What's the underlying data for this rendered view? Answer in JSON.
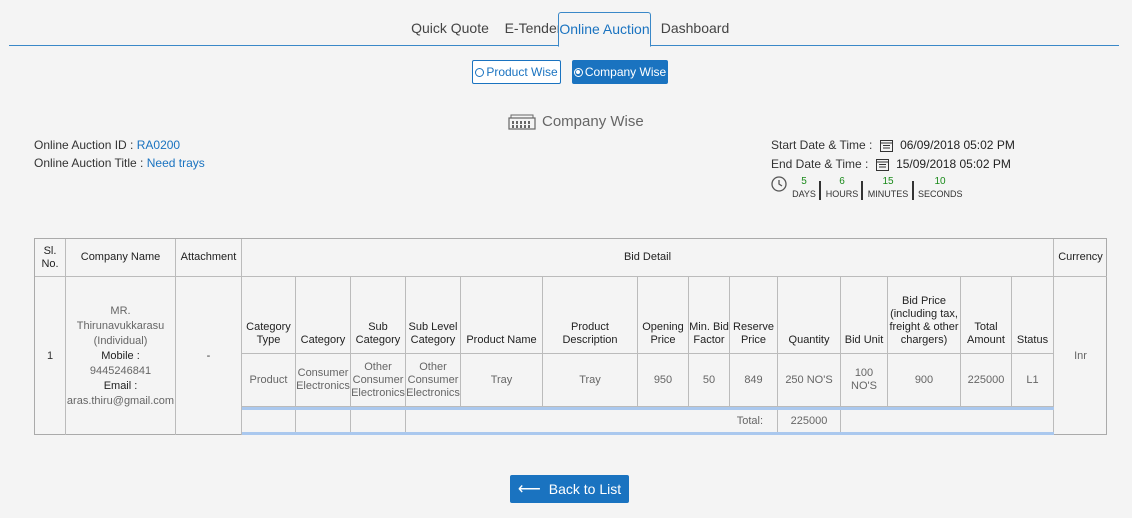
{
  "tabs": [
    {
      "label": "Quick Quote"
    },
    {
      "label": "E-Tender"
    },
    {
      "label": "Online Auction"
    },
    {
      "label": "Dashboard"
    }
  ],
  "toggle": {
    "product_wise": "Product Wise",
    "company_wise": "Company Wise"
  },
  "section_title": "Company Wise",
  "auction": {
    "id_label": "Online Auction ID :",
    "id_value": "RA0200",
    "title_label": "Online Auction Title :",
    "title_value": "Need trays",
    "start_label": "Start Date & Time  :",
    "start_value": "06/09/2018 05:02 PM",
    "end_label": "End Date & Time  :",
    "end_value": "15/09/2018 05:02 PM"
  },
  "countdown": {
    "days": "5",
    "days_label": "DAYS",
    "hours": "6",
    "hours_label": "HOURS",
    "minutes": "15",
    "minutes_label": "MINUTES",
    "seconds": "10",
    "seconds_label": "SECONDS"
  },
  "table": {
    "headers": {
      "sl": "Sl. No.",
      "company": "Company Name",
      "attachment": "Attachment",
      "bid_detail": "Bid Detail",
      "currency": "Currency"
    },
    "sub_headers": [
      "Category Type",
      "Category",
      "Sub Category",
      "Sub Level Category",
      "Product Name",
      "Product Description",
      "Opening Price",
      "Min. Bid Factor",
      "Reserve Price",
      "Quantity",
      "Bid Unit",
      "Bid Price (including tax, freight & other chargers)",
      "Total Amount",
      "Status"
    ],
    "row": {
      "sl": "1",
      "company_name": "MR. Thirunavukkarasu (Individual)",
      "mobile_label": "Mobile :",
      "mobile": "9445246841",
      "email_label": "Email :",
      "email": "aras.thiru@gmail.com",
      "attachment": "-",
      "currency": "Inr",
      "cells": [
        "Product",
        "Consumer Electronics",
        "Other Consumer Electronics",
        "Other Consumer Electronics",
        "Tray",
        "Tray",
        "950",
        "50",
        "849",
        "250 NO'S",
        "100 NO'S",
        "900",
        "225000",
        "L1"
      ]
    },
    "total_label": "Total:",
    "total_value": "225000"
  },
  "back_button": "Back to List"
}
